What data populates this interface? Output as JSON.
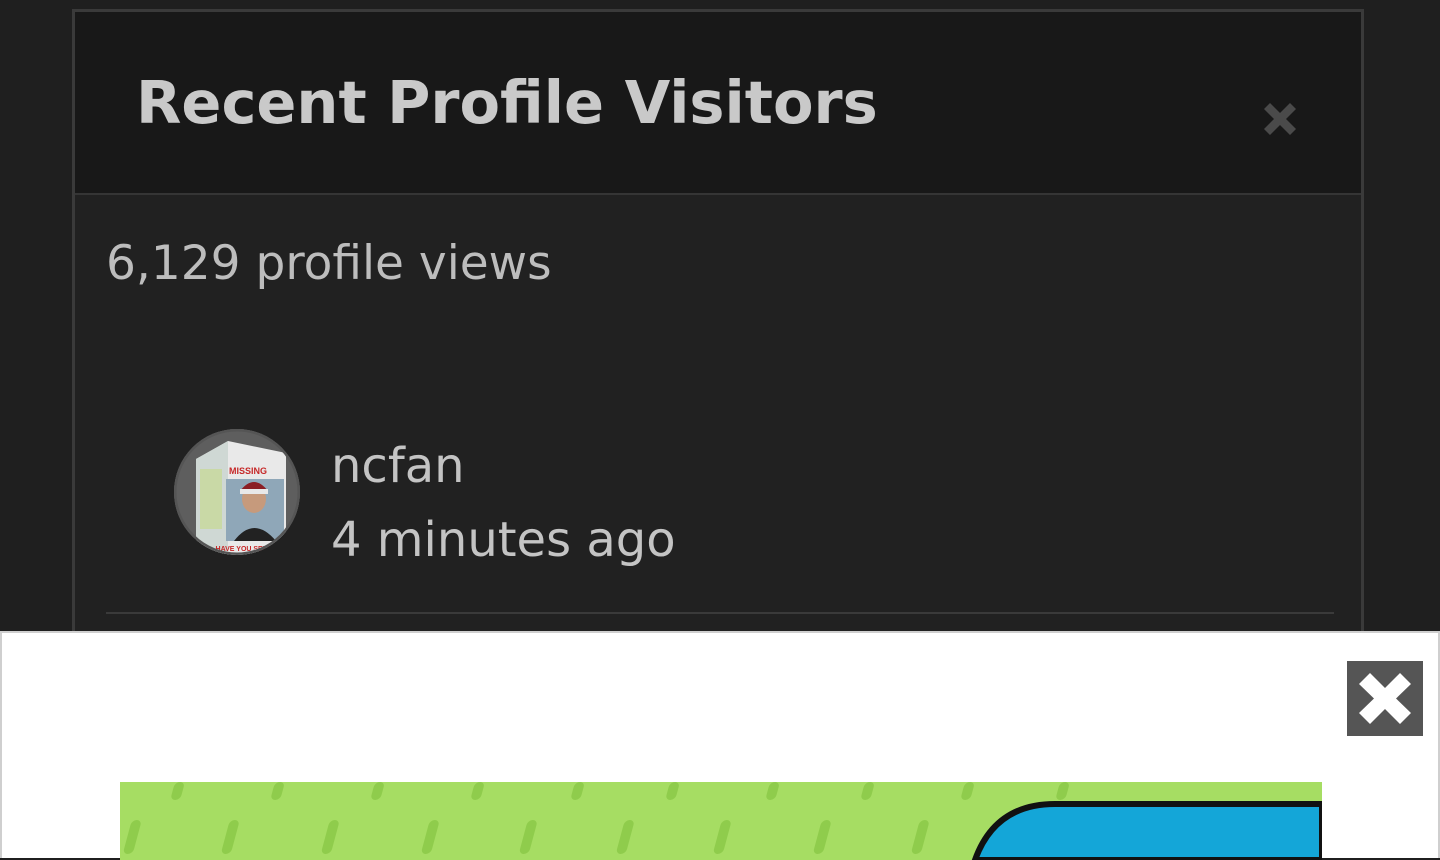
{
  "modal": {
    "title": "Recent Profile Visitors",
    "close_icon": "close-x-icon",
    "views_text": "6,129 profile views",
    "visitors": [
      {
        "name": "ncfan",
        "time": "4 minutes ago",
        "avatar_caption_top": "MISSING",
        "avatar_caption_bottom": "HAVE YOU SEEN"
      }
    ]
  },
  "ad": {
    "close_icon": "close-x-icon",
    "image_colors": {
      "background": "#a6dd63",
      "stripe": "#8fcc4c",
      "shape": "#14a6d8",
      "outline": "#111111"
    }
  },
  "colors": {
    "page_background": "#1f1f1f",
    "modal_background": "#212121",
    "header_background": "#181818",
    "text": "#c4c4c4",
    "ad_background": "#ffffff"
  }
}
